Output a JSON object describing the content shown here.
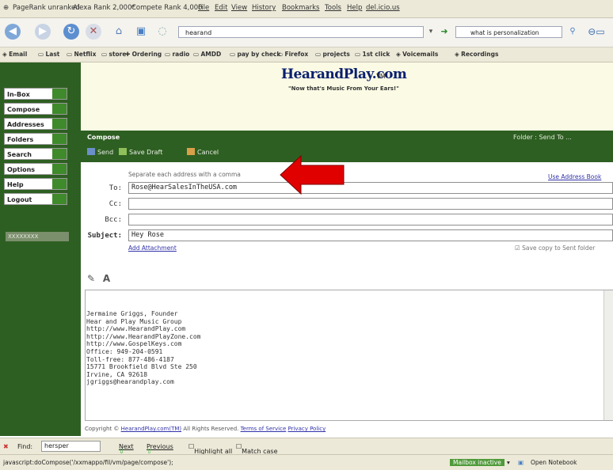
{
  "browser": {
    "menubar": {
      "app_items": [
        "PageRank unranked",
        "Alexa Rank 2,000*",
        "Compete Rank 4,000"
      ],
      "menu_items": [
        "File",
        "Edit",
        "View",
        "History",
        "Bookmarks",
        "Tools",
        "Help",
        "del.icio.us"
      ]
    },
    "url": "hearand",
    "search_placeholder": "what is personalization",
    "bookmarks": [
      "Email",
      "Last",
      "Netflix",
      "store",
      "Ordering",
      "radio",
      "AMDD",
      "pay by check",
      "Firefox",
      "projects",
      "1st click",
      "Voicemails",
      "Recordings"
    ]
  },
  "sidebar": {
    "buttons": [
      "In-Box",
      "Compose",
      "Addresses",
      "Folders",
      "Search",
      "Options",
      "Help",
      "Logout"
    ],
    "badge": "XXXXXXXX"
  },
  "banner": {
    "logo": "HearandPlay.com",
    "tm": "TM",
    "tagline": "\"Now that's Music From Your Ears!\""
  },
  "compose": {
    "title": "Compose",
    "right_links": "Folder :  Send To ...",
    "toolbar": {
      "send": "Send",
      "save_draft": "Save Draft",
      "cancel": "Cancel"
    },
    "hint": "Separate each address with a comma",
    "address_book": "Use Address Book",
    "labels": {
      "to": "To:",
      "cc": "Cc:",
      "bcc": "Bcc:",
      "subject": "Subject:"
    },
    "to_value": "Rose@HearSalesInTheUSA.com",
    "cc_value": "",
    "bcc_value": "",
    "subject_value": "Hey Rose",
    "add_attachment": "Add Attachment",
    "save_copy": "Save copy to Sent folder",
    "editor_tools": [
      "✎",
      "A"
    ]
  },
  "signature": [
    "Jermaine Griggs, Founder",
    "Hear and Play Music Group",
    "http://www.HearandPlay.com",
    "http://www.HearandPlayZone.com",
    "http://www.GospelKeys.com",
    "",
    "Office: 949-204-0591",
    "Toll-free: 877-486-4187",
    "15771 Brookfield Blvd Ste 250",
    "Irvine, CA 92618",
    "jgriggs@hearandplay.com"
  ],
  "footer": {
    "copyright": "Copyright © ",
    "brand": "HearandPlay.com(TM)",
    "rights": " All Rights Reserved. ",
    "terms": "Terms of Service",
    "privacy": "Privacy Policy"
  },
  "findbar": {
    "label": "Find:",
    "value": "hersper",
    "next": "Next",
    "previous": "Previous",
    "highlight": "Highlight all",
    "match_case": "Match case"
  },
  "statusbar": {
    "url": "javascript:doCompose('/xxmappo/fil/vm/page/compose');",
    "indicator": "Mailbox inactive",
    "notebook": "Open Notebook"
  },
  "colors": {
    "sidebar_green": "#2e5f22",
    "accent_green": "#3f8a2b",
    "arrow_red": "#e00000",
    "banner_bg": "#fbfbe5"
  }
}
